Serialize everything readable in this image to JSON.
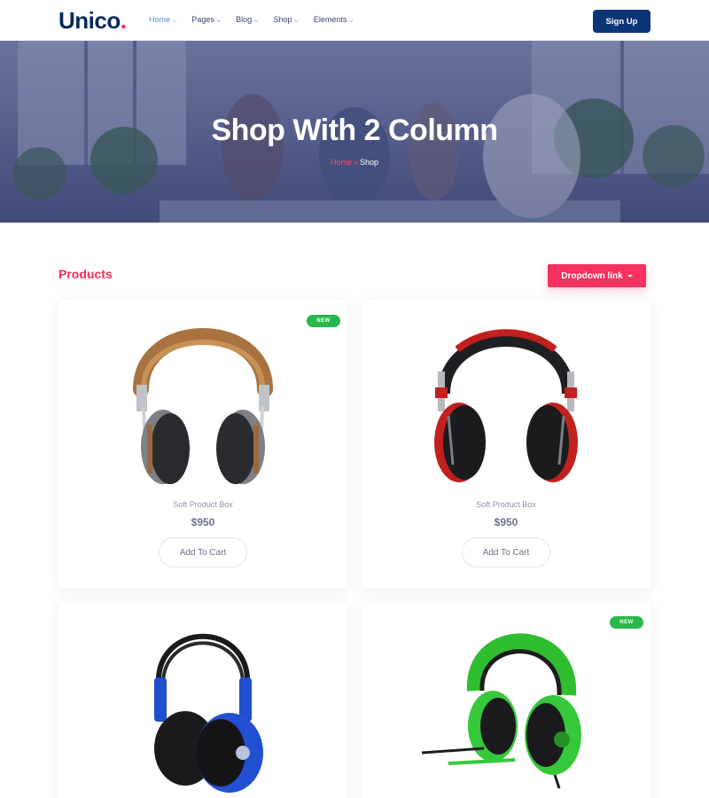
{
  "header": {
    "logo": "Unico",
    "logo_dot": ".",
    "nav": [
      {
        "label": "Home",
        "active": true
      },
      {
        "label": "Pages",
        "active": false
      },
      {
        "label": "Blog",
        "active": false
      },
      {
        "label": "Shop",
        "active": false
      },
      {
        "label": "Elements",
        "active": false
      }
    ],
    "signup_label": "Sign Up"
  },
  "hero": {
    "title": "Shop With 2 Column",
    "breadcrumb_home": "Home",
    "breadcrumb_sep": "»",
    "breadcrumb_current": "Shop"
  },
  "products": {
    "title": "Products",
    "dropdown_label": "Dropdown link",
    "items": [
      {
        "name": "Soft Product Box",
        "price": "$950",
        "cart_label": "Add To Cart",
        "badge": "NEW",
        "image": "brown-headphones"
      },
      {
        "name": "Soft Product Box",
        "price": "$950",
        "cart_label": "Add To Cart",
        "badge": "",
        "image": "red-black-headphones"
      },
      {
        "name": "",
        "price": "",
        "cart_label": "",
        "badge": "",
        "image": "blue-headphones"
      },
      {
        "name": "",
        "price": "",
        "cart_label": "",
        "badge": "NEW",
        "image": "green-headset"
      }
    ]
  },
  "colors": {
    "brand_navy": "#0b3577",
    "accent_pink": "#f7315f",
    "badge_green": "#28b84a",
    "nav_active": "#5a8fe0"
  }
}
